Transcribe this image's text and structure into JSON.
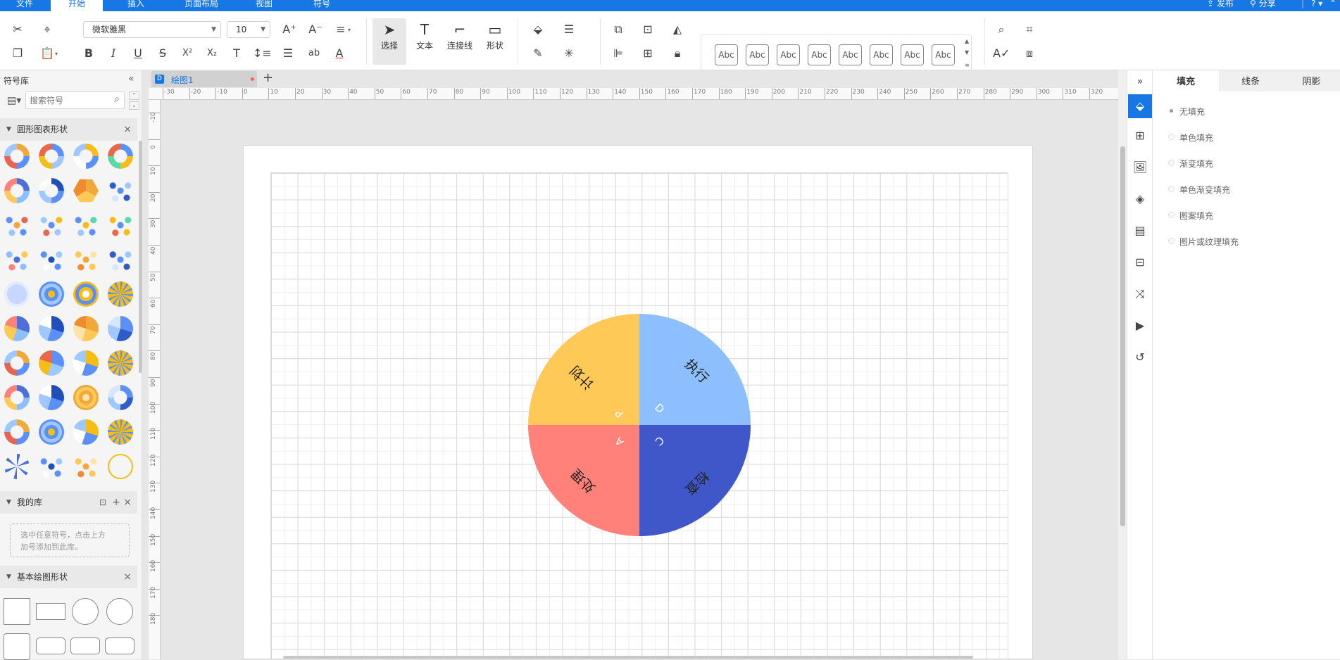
{
  "menubar": {
    "tabs": [
      "文件",
      "开始",
      "插入",
      "页面布局",
      "视图",
      "符号"
    ],
    "active": "开始",
    "right": {
      "publish": "发布",
      "share": "分享",
      "help": "?"
    }
  },
  "toolbar": {
    "font": "微软雅黑",
    "size": "10",
    "tools": {
      "select": "选择",
      "text": "文本",
      "connector": "连接线",
      "shape": "形状"
    },
    "styles": [
      "Abc",
      "Abc",
      "Abc",
      "Abc",
      "Abc",
      "Abc",
      "Abc",
      "Abc"
    ]
  },
  "left": {
    "title": "符号库",
    "search_placeholder": "搜索符号",
    "sections": {
      "chart": "圆形图表形状",
      "mylib": "我的库",
      "basic": "基本绘图形状"
    },
    "mylib_hint1": "选中任意符号，点击上方",
    "mylib_hint2": "加号添加到此库。"
  },
  "doc": {
    "tab": "绘图1",
    "add": "+"
  },
  "ruler": {
    "h": [
      "-30",
      "-20",
      "-10",
      "0",
      "10",
      "20",
      "30",
      "40",
      "50",
      "60",
      "70",
      "80",
      "90",
      "100",
      "110",
      "120",
      "130",
      "140",
      "150",
      "160",
      "170",
      "180",
      "190",
      "200",
      "210",
      "220",
      "230",
      "240",
      "250",
      "260",
      "270",
      "280",
      "290",
      "300",
      "310",
      "320"
    ],
    "v": [
      "-10",
      "0",
      "10",
      "20",
      "30",
      "40",
      "50",
      "60",
      "70",
      "80",
      "90",
      "100",
      "110",
      "120",
      "130",
      "140",
      "150",
      "160",
      "170",
      "180"
    ]
  },
  "diagram": {
    "quadrants": [
      {
        "label": "计划",
        "letter": "P",
        "color": "#ffc957"
      },
      {
        "label": "执行",
        "letter": "D",
        "color": "#8dbfff"
      },
      {
        "label": "检查",
        "letter": "C",
        "color": "#3f57c8"
      },
      {
        "label": "处理",
        "letter": "A",
        "color": "#ff8179"
      }
    ]
  },
  "right": {
    "tabs": [
      "填充",
      "线条",
      "阴影"
    ],
    "active": "填充",
    "options": [
      "无填充",
      "单色填充",
      "渐变填充",
      "单色渐变填充",
      "图案填充",
      "图片或纹理填充"
    ]
  },
  "colors": {
    "brand": "#1677e5"
  }
}
